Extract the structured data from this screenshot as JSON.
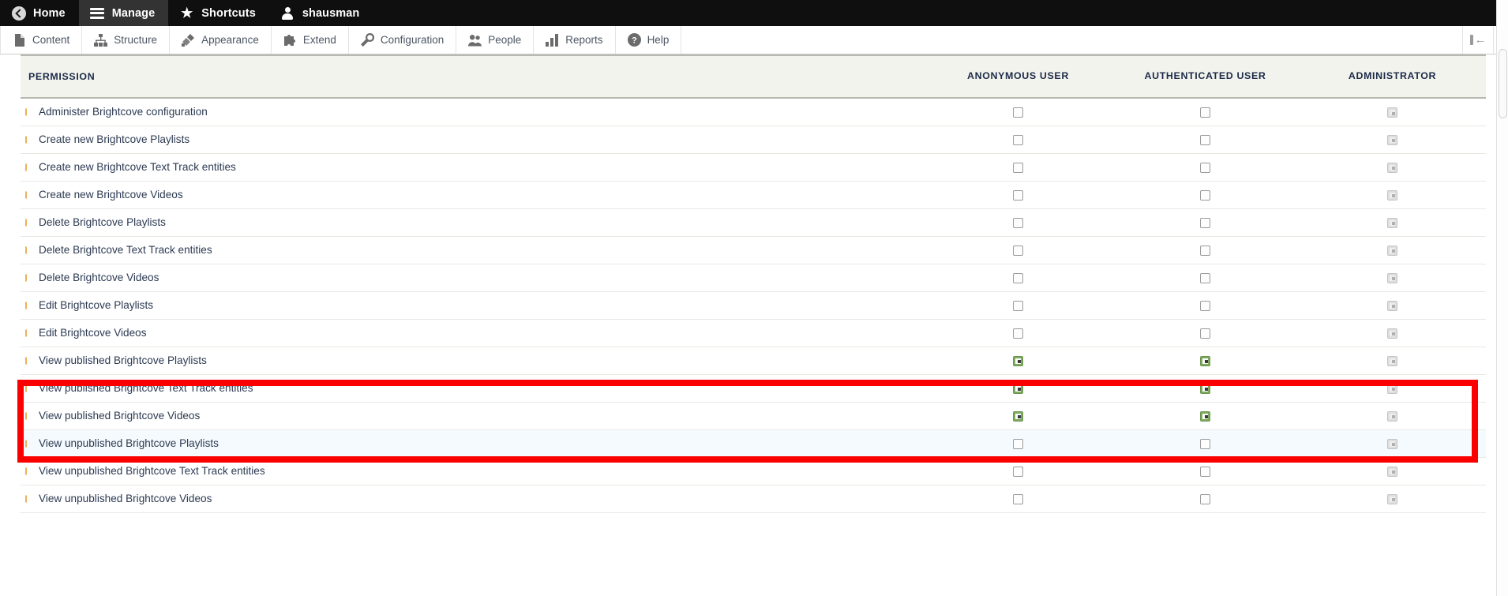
{
  "toolbar": {
    "items": [
      {
        "label": "Home",
        "icon": "back-circle-icon",
        "active": false
      },
      {
        "label": "Manage",
        "icon": "hamburger-icon",
        "active": true
      },
      {
        "label": "Shortcuts",
        "icon": "star-icon",
        "active": false
      },
      {
        "label": "shausman",
        "icon": "person-icon",
        "active": false
      }
    ]
  },
  "subtoolbar": {
    "items": [
      {
        "label": "Content",
        "icon": "document-icon"
      },
      {
        "label": "Structure",
        "icon": "sitemap-icon"
      },
      {
        "label": "Appearance",
        "icon": "paintbrush-icon"
      },
      {
        "label": "Extend",
        "icon": "puzzle-icon"
      },
      {
        "label": "Configuration",
        "icon": "wrench-icon"
      },
      {
        "label": "People",
        "icon": "people-icon"
      },
      {
        "label": "Reports",
        "icon": "bar-chart-icon"
      },
      {
        "label": "Help",
        "icon": "question-circle-icon"
      }
    ],
    "collapse_label": "Collapse toolbar"
  },
  "table": {
    "headers": {
      "permission": "PERMISSION",
      "roles": [
        "ANONYMOUS USER",
        "AUTHENTICATED USER",
        "ADMINISTRATOR"
      ]
    },
    "rows": [
      {
        "permission": "Administer Brightcove configuration",
        "anonymous": "off",
        "authenticated": "off",
        "administrator": "disabled",
        "highlighted": false
      },
      {
        "permission": "Create new Brightcove Playlists",
        "anonymous": "off",
        "authenticated": "off",
        "administrator": "disabled",
        "highlighted": false
      },
      {
        "permission": "Create new Brightcove Text Track entities",
        "anonymous": "off",
        "authenticated": "off",
        "administrator": "disabled",
        "highlighted": false
      },
      {
        "permission": "Create new Brightcove Videos",
        "anonymous": "off",
        "authenticated": "off",
        "administrator": "disabled",
        "highlighted": false
      },
      {
        "permission": "Delete Brightcove Playlists",
        "anonymous": "off",
        "authenticated": "off",
        "administrator": "disabled",
        "highlighted": false
      },
      {
        "permission": "Delete Brightcove Text Track entities",
        "anonymous": "off",
        "authenticated": "off",
        "administrator": "disabled",
        "highlighted": false
      },
      {
        "permission": "Delete Brightcove Videos",
        "anonymous": "off",
        "authenticated": "off",
        "administrator": "disabled",
        "highlighted": false
      },
      {
        "permission": "Edit Brightcove Playlists",
        "anonymous": "off",
        "authenticated": "off",
        "administrator": "disabled",
        "highlighted": false
      },
      {
        "permission": "Edit Brightcove Videos",
        "anonymous": "off",
        "authenticated": "off",
        "administrator": "disabled",
        "highlighted": false
      },
      {
        "permission": "View published Brightcove Playlists",
        "anonymous": "on",
        "authenticated": "on",
        "administrator": "disabled",
        "highlighted": false
      },
      {
        "permission": "View published Brightcove Text Track entities",
        "anonymous": "on",
        "authenticated": "on",
        "administrator": "disabled",
        "highlighted": false
      },
      {
        "permission": "View published Brightcove Videos",
        "anonymous": "on",
        "authenticated": "on",
        "administrator": "disabled",
        "highlighted": false
      },
      {
        "permission": "View unpublished Brightcove Playlists",
        "anonymous": "off",
        "authenticated": "off",
        "administrator": "disabled",
        "highlighted": true
      },
      {
        "permission": "View unpublished Brightcove Text Track entities",
        "anonymous": "off",
        "authenticated": "off",
        "administrator": "disabled",
        "highlighted": false
      },
      {
        "permission": "View unpublished Brightcove Videos",
        "anonymous": "off",
        "authenticated": "off",
        "administrator": "disabled",
        "highlighted": false
      }
    ]
  },
  "annotation": {
    "highlight_color": "#fb0000",
    "highlighted_rows": [
      "View published Brightcove Playlists",
      "View published Brightcove Text Track entities",
      "View published Brightcove Videos"
    ]
  },
  "colors": {
    "toolbar_bg": "#0f0f0f",
    "toolbar_active": "#333333",
    "header_bg": "#f3f3ee",
    "checkbox_on": "#7eaa5e",
    "row_highlight_bg": "#f4fafd"
  }
}
